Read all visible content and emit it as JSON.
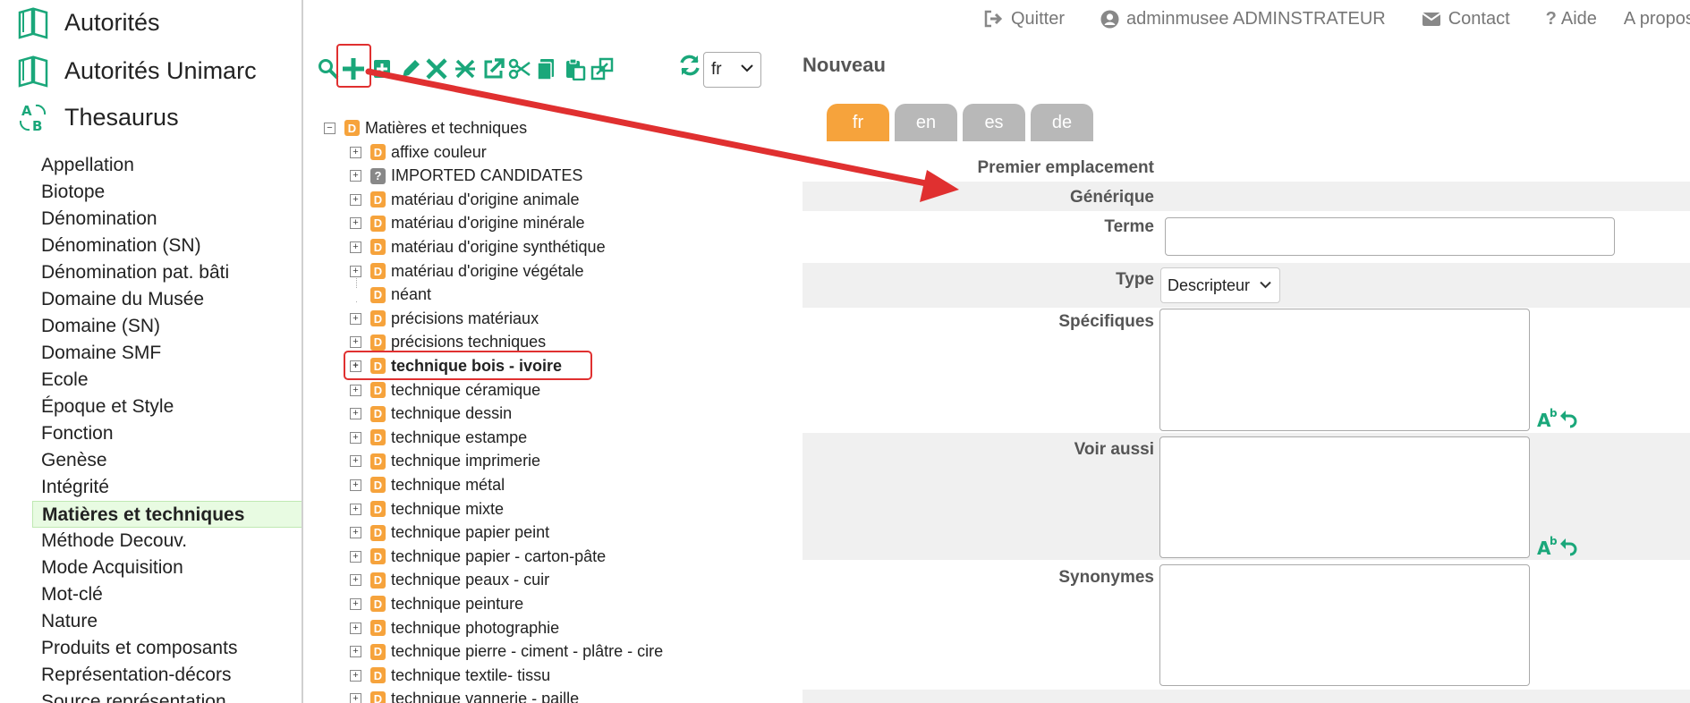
{
  "modules": [
    {
      "label": "Autorités",
      "icon": "book-icon"
    },
    {
      "label": "Autorités Unimarc",
      "icon": "book-icon"
    },
    {
      "label": "Thesaurus",
      "icon": "thesaurus-ab-icon"
    }
  ],
  "thesauri": [
    "Appellation",
    "Biotope",
    "Dénomination",
    "Dénomination (SN)",
    "Dénomination pat. bâti",
    "Domaine du Musée",
    "Domaine (SN)",
    "Domaine SMF",
    "Ecole",
    "Époque et Style",
    "Fonction",
    "Genèse",
    "Intégrité",
    "Matières et techniques",
    "Méthode Decouv.",
    "Mode Acquisition",
    "Mot-clé",
    "Nature",
    "Produits et composants",
    "Représentation-décors",
    "Source représentation"
  ],
  "thesauri_active": "Matières et techniques",
  "topbar": {
    "quit": "Quitter",
    "user": "adminmusee ADMINSTRATEUR",
    "contact": "Contact",
    "help": "Aide",
    "about": "A propos"
  },
  "toolbar": {
    "icons": [
      "search-icon",
      "add-icon",
      "add-child-icon",
      "edit-icon",
      "delete-icon",
      "merge-icon",
      "open-external-icon",
      "cut-icon",
      "copy-icon",
      "paste-icon",
      "move-icon"
    ],
    "highlighted": "add-icon",
    "language": "fr"
  },
  "tree": {
    "root": "Matières et techniques",
    "nodes": [
      {
        "label": "affixe couleur",
        "badge": "D",
        "toggle": "+"
      },
      {
        "label": "IMPORTED CANDIDATES",
        "badge": "?",
        "toggle": "+"
      },
      {
        "label": "matériau d'origine animale",
        "badge": "D",
        "toggle": "+"
      },
      {
        "label": "matériau d'origine minérale",
        "badge": "D",
        "toggle": "+"
      },
      {
        "label": "matériau d'origine synthétique",
        "badge": "D",
        "toggle": "+"
      },
      {
        "label": "matériau d'origine végétale",
        "badge": "D",
        "toggle": "+"
      },
      {
        "label": "néant",
        "badge": "D",
        "toggle": ""
      },
      {
        "label": "précisions matériaux",
        "badge": "D",
        "toggle": "+"
      },
      {
        "label": "précisions techniques",
        "badge": "D",
        "toggle": "+"
      },
      {
        "label": "technique bois - ivoire",
        "badge": "D",
        "toggle": "+",
        "selected": true
      },
      {
        "label": "technique céramique",
        "badge": "D",
        "toggle": "+"
      },
      {
        "label": "technique dessin",
        "badge": "D",
        "toggle": "+"
      },
      {
        "label": "technique estampe",
        "badge": "D",
        "toggle": "+"
      },
      {
        "label": "technique imprimerie",
        "badge": "D",
        "toggle": "+"
      },
      {
        "label": "technique métal",
        "badge": "D",
        "toggle": "+"
      },
      {
        "label": "technique mixte",
        "badge": "D",
        "toggle": "+"
      },
      {
        "label": "technique papier peint",
        "badge": "D",
        "toggle": "+"
      },
      {
        "label": "technique papier - carton-pâte",
        "badge": "D",
        "toggle": "+"
      },
      {
        "label": "technique peaux - cuir",
        "badge": "D",
        "toggle": "+"
      },
      {
        "label": "technique peinture",
        "badge": "D",
        "toggle": "+"
      },
      {
        "label": "technique photographie",
        "badge": "D",
        "toggle": "+"
      },
      {
        "label": "technique pierre - ciment - plâtre - cire",
        "badge": "D",
        "toggle": "+"
      },
      {
        "label": "technique textile- tissu",
        "badge": "D",
        "toggle": "+"
      },
      {
        "label": "technique vannerie - paille",
        "badge": "D",
        "toggle": "+"
      }
    ]
  },
  "form": {
    "title": "Nouveau",
    "tabs": [
      "fr",
      "en",
      "es",
      "de"
    ],
    "active_tab": "fr",
    "premier_emplacement": "Premier emplacement",
    "generique": "Générique",
    "terme_label": "Terme",
    "terme_value": "",
    "type_label": "Type",
    "type_value": "Descripteur",
    "specifiques_label": "Spécifiques",
    "voir_aussi_label": "Voir aussi",
    "synonymes_label": "Synonymes"
  },
  "colors": {
    "accent_orange": "#f6a33c",
    "icon_green": "#1aa77a",
    "annotation_red": "#e03030",
    "active_item_bg": "#e8fbe2"
  }
}
